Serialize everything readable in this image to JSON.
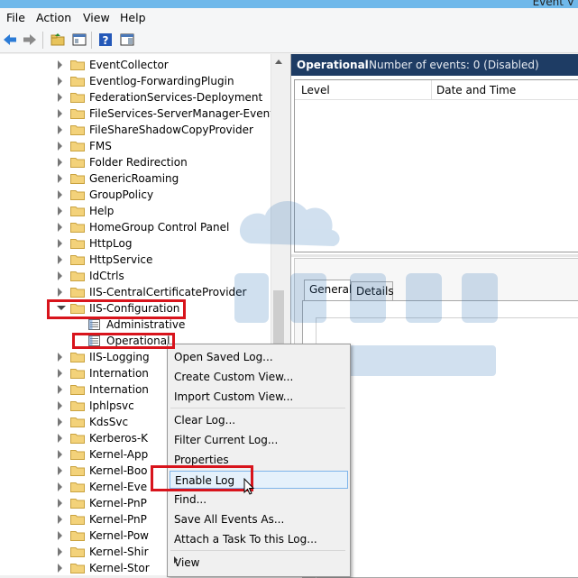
{
  "window": {
    "title_fragment": "Event V"
  },
  "menu": {
    "file": "File",
    "action": "Action",
    "view": "View",
    "help": "Help"
  },
  "toolbar": {
    "back_icon": "back-arrow-icon",
    "forward_icon": "forward-arrow-icon",
    "folder_icon": "folder-up-icon",
    "show_hide_icon": "show-hide-pane-icon",
    "help_icon": "help-icon",
    "properties_icon": "properties-pane-icon"
  },
  "tree": {
    "items": [
      {
        "label": "EventCollector"
      },
      {
        "label": "Eventlog-ForwardingPlugin"
      },
      {
        "label": "FederationServices-Deployment"
      },
      {
        "label": "FileServices-ServerManager-EventProv"
      },
      {
        "label": "FileShareShadowCopyProvider"
      },
      {
        "label": "FMS"
      },
      {
        "label": "Folder Redirection"
      },
      {
        "label": "GenericRoaming"
      },
      {
        "label": "GroupPolicy"
      },
      {
        "label": "Help"
      },
      {
        "label": "HomeGroup Control Panel"
      },
      {
        "label": "HttpLog"
      },
      {
        "label": "HttpService"
      },
      {
        "label": "IdCtrls"
      },
      {
        "label": "IIS-CentralCertificateProvider"
      },
      {
        "label": "IIS-Configuration"
      }
    ],
    "children": [
      {
        "label": "Administrative"
      },
      {
        "label": "Operational"
      }
    ],
    "after": [
      {
        "label": "IIS-Logging"
      },
      {
        "label": "Internation"
      },
      {
        "label": "Internation"
      },
      {
        "label": "Iphlpsvc"
      },
      {
        "label": "KdsSvc"
      },
      {
        "label": "Kerberos-K"
      },
      {
        "label": "Kernel-App"
      },
      {
        "label": "Kernel-Boo"
      },
      {
        "label": "Kernel-Eve"
      },
      {
        "label": "Kernel-PnP"
      },
      {
        "label": "Kernel-PnP"
      },
      {
        "label": "Kernel-Pow"
      },
      {
        "label": "Kernel-Shir"
      },
      {
        "label": "Kernel-Stor"
      }
    ]
  },
  "right": {
    "header_title": "Operational",
    "header_info": "Number of events: 0 (Disabled)",
    "col_level": "Level",
    "col_date": "Date and Time",
    "tab_general": "General",
    "tab_details": "Details"
  },
  "context_menu": {
    "items": [
      {
        "label": "Open Saved Log..."
      },
      {
        "label": "Create Custom View..."
      },
      {
        "label": "Import Custom View..."
      },
      {
        "label": "Clear Log..."
      },
      {
        "label": "Filter Current Log..."
      },
      {
        "label": "Properties"
      },
      {
        "label": "Enable Log"
      },
      {
        "label": "Find..."
      },
      {
        "label": "Save All Events As..."
      },
      {
        "label": "Attach a Task To this Log..."
      },
      {
        "label": "View"
      }
    ]
  },
  "colors": {
    "header_bg": "#1e3c64",
    "highlight_red": "#d8141c",
    "hover_bg": "#e5f1fb",
    "titlebar": "#6fb8ea"
  }
}
